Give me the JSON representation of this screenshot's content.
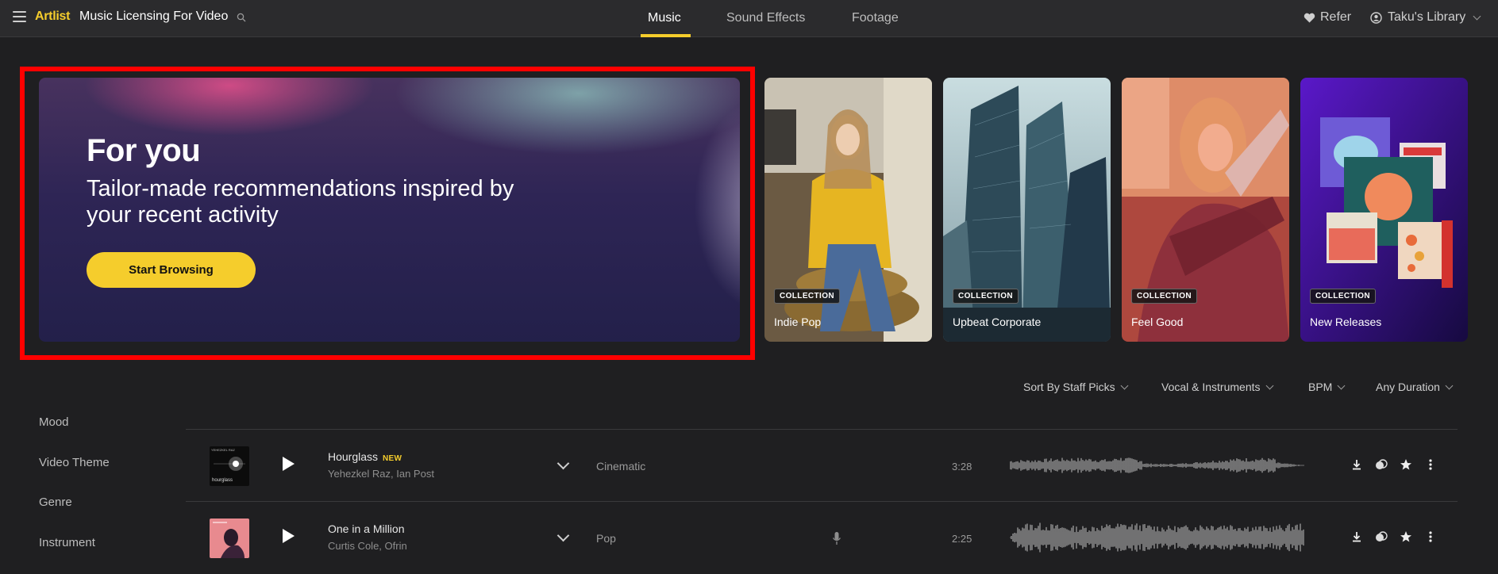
{
  "header": {
    "logo": "Artlist",
    "site_title": "Music Licensing For Video",
    "tabs": [
      "Music",
      "Sound Effects",
      "Footage"
    ],
    "active_tab": "Music",
    "refer": "Refer",
    "library": "Taku's Library",
    "accent_color": "#f5cd2c"
  },
  "hero": {
    "title": "For you",
    "subtitle": "Tailor-made recommendations inspired by your recent activity",
    "button": "Start Browsing",
    "highlight_color": "#ff0000"
  },
  "collections": [
    {
      "badge": "COLLECTION",
      "name": "Indie Pop"
    },
    {
      "badge": "COLLECTION",
      "name": "Upbeat Corporate"
    },
    {
      "badge": "COLLECTION",
      "name": "Feel Good"
    },
    {
      "badge": "COLLECTION",
      "name": "New Releases"
    }
  ],
  "filters": [
    "Sort By Staff Picks",
    "Vocal & Instruments",
    "BPM",
    "Any Duration"
  ],
  "sidebar": [
    "Mood",
    "Video Theme",
    "Genre",
    "Instrument"
  ],
  "tracks": [
    {
      "title": "Hourglass",
      "badge": "NEW",
      "artists": "Yehezkel Raz, Ian Post",
      "genre": "Cinematic",
      "duration": "3:28",
      "vocal": false,
      "art_label_top": "YEHEZKEL RAZ",
      "art_label_bottom": "hourglass"
    },
    {
      "title": "One in a Million",
      "badge": "",
      "artists": "Curtis Cole, Ofrin",
      "genre": "Pop",
      "duration": "2:25",
      "vocal": true
    }
  ]
}
